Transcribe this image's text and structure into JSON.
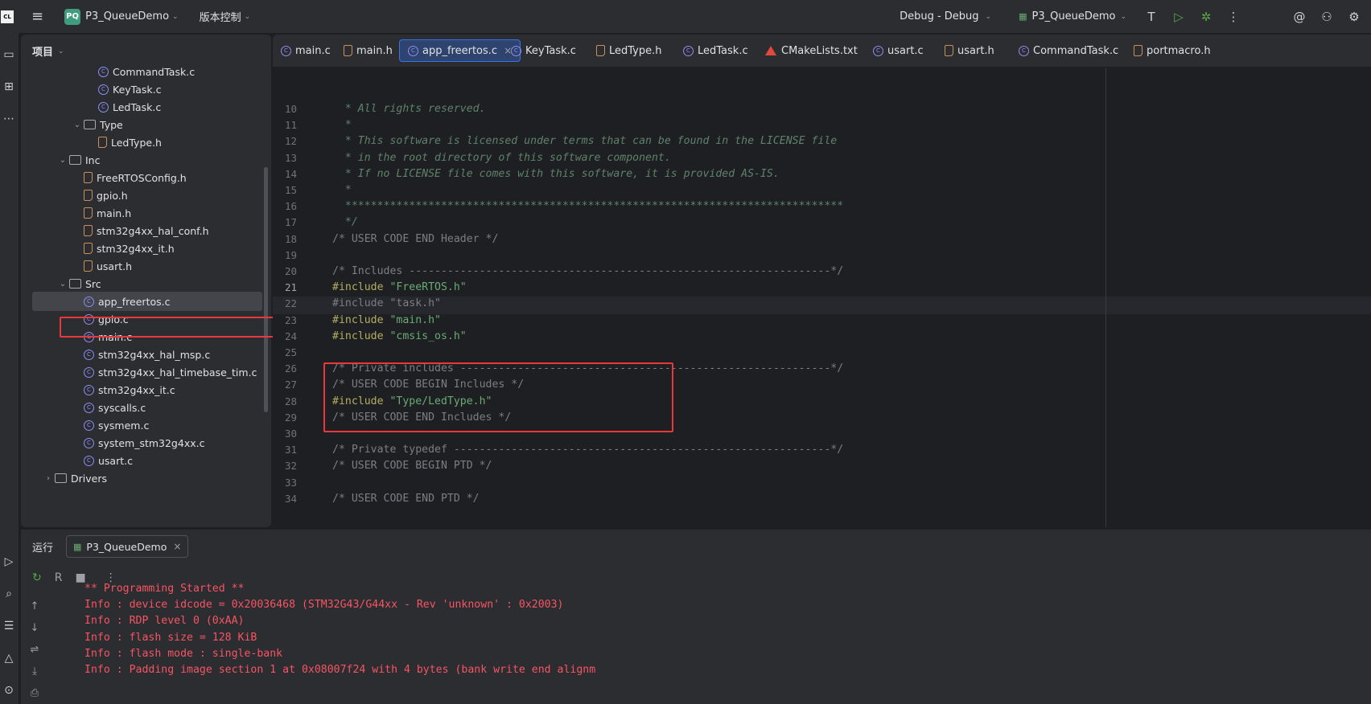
{
  "titlebar": {
    "logo_text": "CL",
    "project_badge": "PQ",
    "project_name": "P3_QueueDemo",
    "vcs_label": "版本控制",
    "run_config": "Debug - Debug",
    "target": "P3_QueueDemo"
  },
  "project_panel": {
    "title": "项目",
    "tree": [
      {
        "label": "CommandTask.c",
        "type": "c"
      },
      {
        "label": "KeyTask.c",
        "type": "c"
      },
      {
        "label": "LedTask.c",
        "type": "c"
      },
      {
        "label": "Type",
        "type": "folder"
      },
      {
        "label": "LedType.h",
        "type": "h"
      },
      {
        "label": "Inc",
        "type": "folder"
      },
      {
        "label": "FreeRTOSConfig.h",
        "type": "h"
      },
      {
        "label": "gpio.h",
        "type": "h"
      },
      {
        "label": "main.h",
        "type": "h"
      },
      {
        "label": "stm32g4xx_hal_conf.h",
        "type": "h"
      },
      {
        "label": "stm32g4xx_it.h",
        "type": "h"
      },
      {
        "label": "usart.h",
        "type": "h"
      },
      {
        "label": "Src",
        "type": "folder"
      },
      {
        "label": "app_freertos.c",
        "type": "c",
        "selected": true
      },
      {
        "label": "gpio.c",
        "type": "c"
      },
      {
        "label": "main.c",
        "type": "c"
      },
      {
        "label": "stm32g4xx_hal_msp.c",
        "type": "c"
      },
      {
        "label": "stm32g4xx_hal_timebase_tim.c",
        "type": "c"
      },
      {
        "label": "stm32g4xx_it.c",
        "type": "c"
      },
      {
        "label": "syscalls.c",
        "type": "c"
      },
      {
        "label": "sysmem.c",
        "type": "c"
      },
      {
        "label": "system_stm32g4xx.c",
        "type": "c"
      },
      {
        "label": "usart.c",
        "type": "c"
      },
      {
        "label": "Drivers",
        "type": "folder"
      }
    ]
  },
  "editor": {
    "tabs": [
      {
        "label": "main.c",
        "type": "c"
      },
      {
        "label": "main.h",
        "type": "h"
      },
      {
        "label": "app_freertos.c",
        "type": "c",
        "active": true
      },
      {
        "label": "KeyTask.c",
        "type": "c"
      },
      {
        "label": "LedType.h",
        "type": "h"
      },
      {
        "label": "LedTask.c",
        "type": "c"
      },
      {
        "label": "CMakeLists.txt",
        "type": "cmake"
      },
      {
        "label": "usart.c",
        "type": "c"
      },
      {
        "label": "usart.h",
        "type": "h"
      },
      {
        "label": "CommandTask.c",
        "type": "c"
      },
      {
        "label": "portmacro.h",
        "type": "h"
      }
    ],
    "current_line": 21,
    "lines": [
      {
        "n": "10",
        "parts": [
          {
            "t": "  * All rights reserved.",
            "c": "doc"
          }
        ]
      },
      {
        "n": "11",
        "parts": [
          {
            "t": "  *",
            "c": "doc"
          }
        ]
      },
      {
        "n": "12",
        "parts": [
          {
            "t": "  * This software is licensed under terms that can be found in the LICENSE file",
            "c": "doc"
          }
        ]
      },
      {
        "n": "13",
        "parts": [
          {
            "t": "  * in the root directory of this software component.",
            "c": "doc"
          }
        ]
      },
      {
        "n": "14",
        "parts": [
          {
            "t": "  * If no LICENSE file comes with this software, it is provided AS-IS.",
            "c": "doc"
          }
        ]
      },
      {
        "n": "15",
        "parts": [
          {
            "t": "  *",
            "c": "doc"
          }
        ]
      },
      {
        "n": "16",
        "parts": [
          {
            "t": "  ******************************************************************************",
            "c": "doc"
          }
        ]
      },
      {
        "n": "17",
        "parts": [
          {
            "t": "  */",
            "c": "doc"
          }
        ]
      },
      {
        "n": "18",
        "parts": [
          {
            "t": "/* USER CODE END Header */",
            "c": "cmt"
          }
        ]
      },
      {
        "n": "19",
        "parts": []
      },
      {
        "n": "20",
        "parts": [
          {
            "t": "/* Includes ------------------------------------------------------------------*/",
            "c": "cmt"
          }
        ]
      },
      {
        "n": "21",
        "parts": [
          {
            "t": "#include ",
            "c": "kw"
          },
          {
            "t": "\"FreeRTOS.h\"",
            "c": "str"
          }
        ]
      },
      {
        "n": "22",
        "parts": [
          {
            "t": "#include \"task.h\"",
            "c": "cmt"
          }
        ]
      },
      {
        "n": "23",
        "parts": [
          {
            "t": "#include ",
            "c": "kw"
          },
          {
            "t": "\"main.h\"",
            "c": "str"
          }
        ]
      },
      {
        "n": "24",
        "parts": [
          {
            "t": "#include ",
            "c": "kw"
          },
          {
            "t": "\"cmsis_os.h\"",
            "c": "str"
          }
        ]
      },
      {
        "n": "25",
        "parts": []
      },
      {
        "n": "26",
        "parts": [
          {
            "t": "/* Private includes ----------------------------------------------------------*/",
            "c": "cmt"
          }
        ]
      },
      {
        "n": "27",
        "parts": [
          {
            "t": "/* USER CODE BEGIN Includes */",
            "c": "cmt"
          }
        ]
      },
      {
        "n": "28",
        "parts": [
          {
            "t": "#include ",
            "c": "kw"
          },
          {
            "t": "\"Type/LedType.h\"",
            "c": "str"
          }
        ]
      },
      {
        "n": "29",
        "parts": [
          {
            "t": "/* USER CODE END Includes */",
            "c": "cmt"
          }
        ]
      },
      {
        "n": "30",
        "parts": []
      },
      {
        "n": "31",
        "parts": [
          {
            "t": "/* Private typedef -----------------------------------------------------------*/",
            "c": "cmt"
          }
        ]
      },
      {
        "n": "32",
        "parts": [
          {
            "t": "/* USER CODE BEGIN PTD */",
            "c": "cmt"
          }
        ]
      },
      {
        "n": "33",
        "parts": []
      },
      {
        "n": "34",
        "parts": [
          {
            "t": "/* USER CODE END PTD */",
            "c": "cmt"
          }
        ]
      }
    ]
  },
  "run_panel": {
    "title": "运行",
    "tab_label": "P3_QueueDemo",
    "console": [
      "** Programming Started **",
      "Info : device idcode = 0x20036468 (STM32G43/G44xx - Rev 'unknown' : 0x2003)",
      "Info : RDP level 0 (0xAA)",
      "Info : flash size = 128 KiB",
      "Info : flash mode : single-bank",
      "Info : Padding image section 1 at 0x08007f24 with 4 bytes (bank write end alignm"
    ]
  },
  "colors": {
    "highlight_box": "#e8383a",
    "console_text": "#f75464",
    "accent": "#3574f0"
  }
}
